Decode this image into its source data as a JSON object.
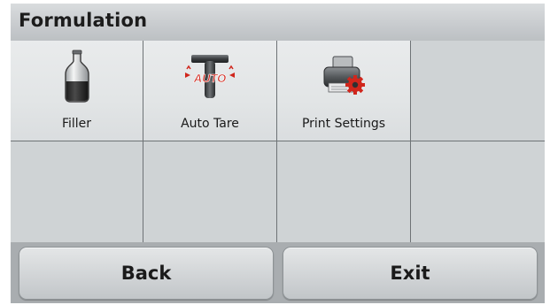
{
  "header": {
    "title": "Formulation"
  },
  "menu": {
    "items": [
      {
        "label": "Filler",
        "icon": "bottle-icon"
      },
      {
        "label": "Auto Tare",
        "icon": "auto-tare-icon"
      },
      {
        "label": "Print Settings",
        "icon": "printer-settings-icon"
      }
    ]
  },
  "footer": {
    "back_label": "Back",
    "exit_label": "Exit"
  },
  "colors": {
    "accent_red": "#d0261c",
    "background": "#c7cbce"
  }
}
